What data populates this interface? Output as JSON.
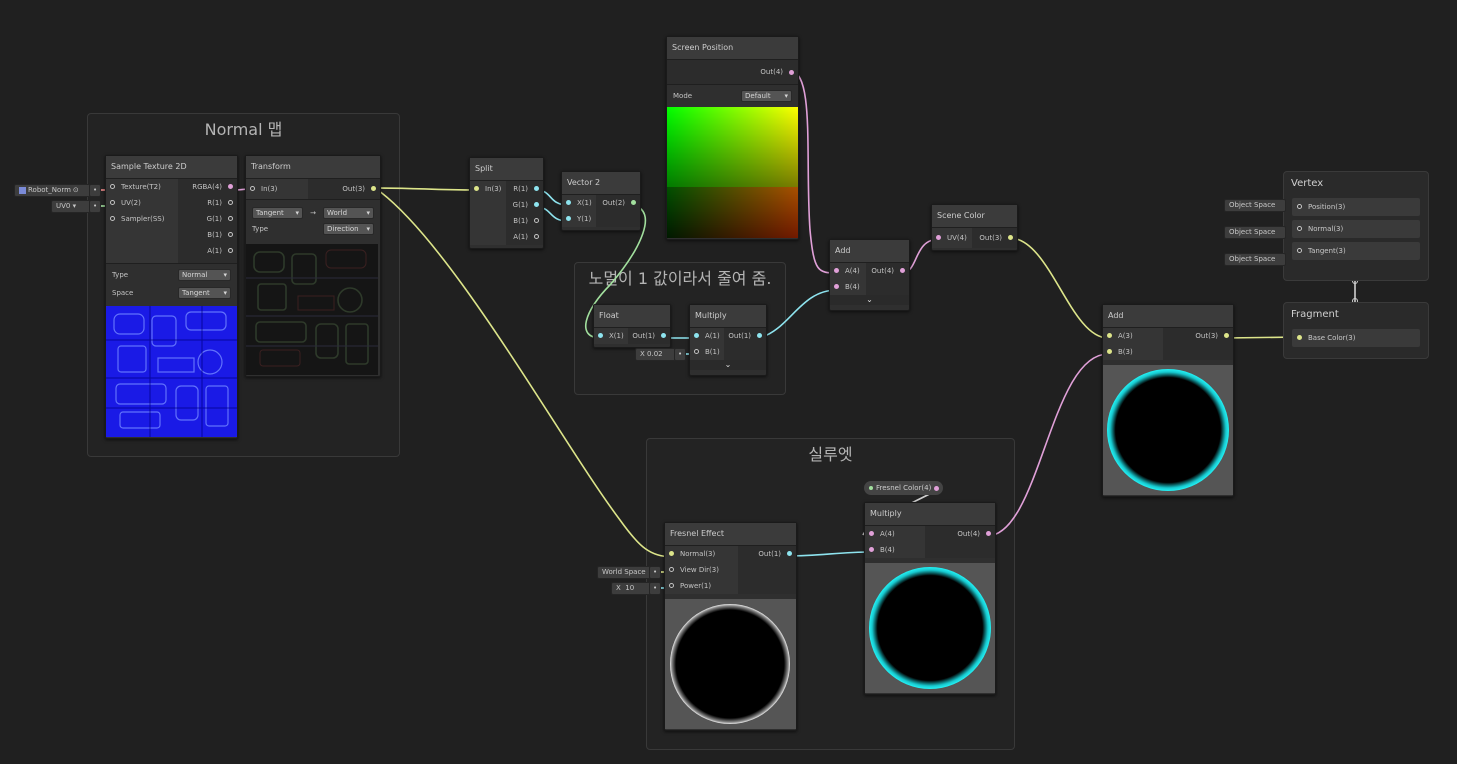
{
  "groups": {
    "normal_map": {
      "title": "Normal 맵"
    },
    "noemal_note": {
      "title": "노멀이 1 값이라서 줄여 줌."
    },
    "silhouette": {
      "title": "실루엣"
    }
  },
  "nodes": {
    "sample_texture": {
      "title": "Sample Texture 2D",
      "inputs": [
        "Texture(T2)",
        "UV(2)",
        "Sampler(SS)"
      ],
      "outputs": [
        "RGBA(4)",
        "R(1)",
        "G(1)",
        "B(1)",
        "A(1)"
      ],
      "type_label": "Type",
      "type_value": "Normal",
      "space_label": "Space",
      "space_value": "Tangent"
    },
    "transform": {
      "title": "Transform",
      "input": "In(3)",
      "output": "Out(3)",
      "from": "Tangent",
      "arrow": "→",
      "to": "World",
      "type_label": "Type",
      "type_value": "Direction"
    },
    "split": {
      "title": "Split",
      "input": "In(3)",
      "outputs": [
        "R(1)",
        "G(1)",
        "B(1)",
        "A(1)"
      ]
    },
    "vector2": {
      "title": "Vector 2",
      "inputs": [
        "X(1)",
        "Y(1)"
      ],
      "output": "Out(2)"
    },
    "screen_position": {
      "title": "Screen Position",
      "output": "Out(4)",
      "mode_label": "Mode",
      "mode_value": "Default"
    },
    "add1": {
      "title": "Add",
      "inputs": [
        "A(4)",
        "B(4)"
      ],
      "output": "Out(4)"
    },
    "scene_color": {
      "title": "Scene Color",
      "input": "UV(4)",
      "output": "Out(3)"
    },
    "float": {
      "title": "Float",
      "input": "X(1)",
      "output": "Out(1)"
    },
    "multiply1": {
      "title": "Multiply",
      "inputs": [
        "A(1)",
        "B(1)"
      ],
      "output": "Out(1)"
    },
    "add2": {
      "title": "Add",
      "inputs": [
        "A(3)",
        "B(3)"
      ],
      "output": "Out(3)"
    },
    "fresnel": {
      "title": "Fresnel Effect",
      "inputs": [
        "Normal(3)",
        "View Dir(3)",
        "Power(1)"
      ],
      "output": "Out(1)"
    },
    "multiply2": {
      "title": "Multiply",
      "inputs": [
        "A(4)",
        "B(4)"
      ],
      "output": "Out(4)"
    }
  },
  "property_chip": {
    "label": "Fresnel Color(4)"
  },
  "inline_inputs": {
    "robot_normal": "Robot_Norm",
    "uv": "UV0",
    "float_x_label": "X",
    "float_x_value": "0.02",
    "world_space": "World Space",
    "power_x_label": "X",
    "power_value": "10"
  },
  "master": {
    "vertex": {
      "title": "Vertex",
      "rows": [
        {
          "chip": "Object Space",
          "label": "Position(3)"
        },
        {
          "chip": "Object Space",
          "label": "Normal(3)"
        },
        {
          "chip": "Object Space",
          "label": "Tangent(3)"
        }
      ]
    },
    "fragment": {
      "title": "Fragment",
      "rows": [
        {
          "label": "Base Color(3)"
        }
      ]
    }
  },
  "colors": {
    "background": "#202020",
    "wire_yellow": "#dde58a",
    "wire_pink": "#e0a0d8",
    "wire_cyan": "#8ee4ef",
    "glow_cyan": "#1fe8ee"
  }
}
